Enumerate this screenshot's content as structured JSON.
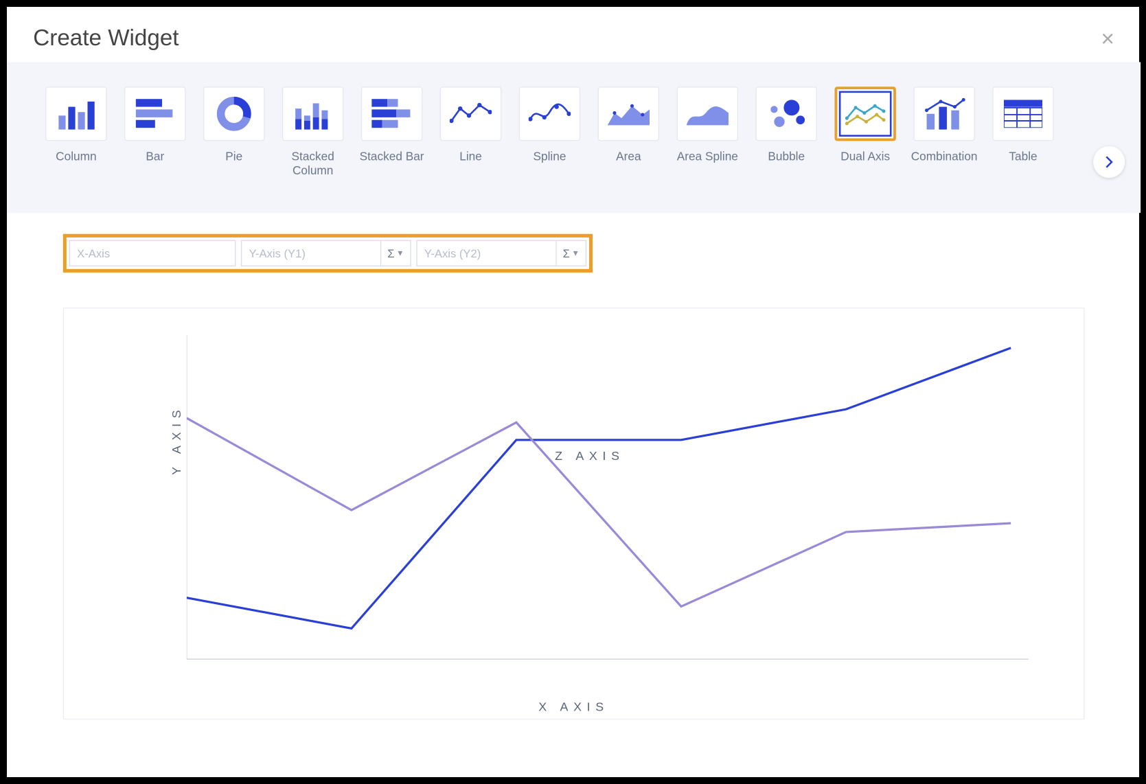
{
  "dialog": {
    "title": "Create Widget"
  },
  "chart_types": [
    {
      "id": "column",
      "label": "Column",
      "selected": false
    },
    {
      "id": "bar",
      "label": "Bar",
      "selected": false
    },
    {
      "id": "pie",
      "label": "Pie",
      "selected": false
    },
    {
      "id": "stacked-column",
      "label": "Stacked Column",
      "selected": false
    },
    {
      "id": "stacked-bar",
      "label": "Stacked Bar",
      "selected": false
    },
    {
      "id": "line",
      "label": "Line",
      "selected": false
    },
    {
      "id": "spline",
      "label": "Spline",
      "selected": false
    },
    {
      "id": "area",
      "label": "Area",
      "selected": false
    },
    {
      "id": "area-spline",
      "label": "Area Spline",
      "selected": false
    },
    {
      "id": "bubble",
      "label": "Bubble",
      "selected": false
    },
    {
      "id": "dual-axis",
      "label": "Dual Axis",
      "selected": true
    },
    {
      "id": "combination",
      "label": "Combination",
      "selected": false
    },
    {
      "id": "table",
      "label": "Table",
      "selected": false
    }
  ],
  "axis_inputs": {
    "x": {
      "placeholder": "X-Axis",
      "value": ""
    },
    "y1": {
      "placeholder": "Y-Axis (Y1)",
      "value": ""
    },
    "y2": {
      "placeholder": "Y-Axis (Y2)",
      "value": ""
    },
    "agg_symbol": "Σ"
  },
  "preview_labels": {
    "y": "Y AXIS",
    "z": "Z AXIS",
    "x": "X AXIS"
  },
  "chart_data": {
    "type": "line",
    "note": "Placeholder dual-axis preview; no numeric scale rendered.",
    "xlabel": "X AXIS",
    "series": [
      {
        "name": "Y AXIS",
        "axis": "y1",
        "color": "#2a3fd6",
        "x": [
          0,
          1,
          2,
          3,
          4,
          5
        ],
        "values": [
          300,
          335,
          120,
          120,
          85,
          15
        ]
      },
      {
        "name": "Z AXIS",
        "axis": "y2",
        "color": "#9a8ad6",
        "x": [
          0,
          1,
          2,
          3,
          4,
          5
        ],
        "values": [
          95,
          200,
          100,
          310,
          225,
          215
        ]
      }
    ]
  },
  "colors": {
    "brand": "#2a3fd6",
    "brand_light": "#8090e8",
    "highlight": "#e8a02a"
  }
}
